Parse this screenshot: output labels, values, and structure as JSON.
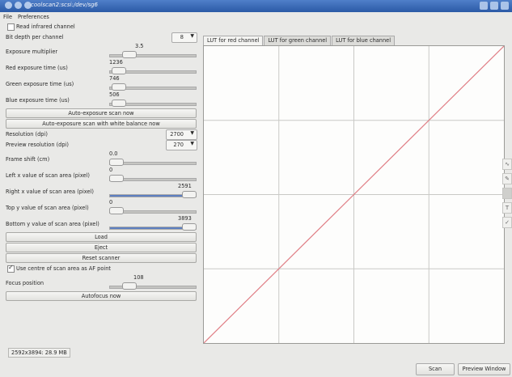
{
  "window": {
    "title": "coolscan2:scsi:/dev/sg6"
  },
  "menu": {
    "items": [
      "File",
      "Preferences"
    ]
  },
  "left": {
    "read_infrared_label": "Read infrared channel",
    "bit_depth_label": "Bit depth per channel",
    "bit_depth_value": "8",
    "exposure_multiplier_label": "Exposure multiplier",
    "exposure_multiplier_value": "3.5",
    "red_exposure_label": "Red exposure time (us)",
    "red_exposure_value": "1236",
    "green_exposure_label": "Green exposure time (us)",
    "green_exposure_value": "746",
    "blue_exposure_label": "Blue exposure time (us)",
    "blue_exposure_value": "506",
    "auto_exposure_btn": "Auto-exposure scan now",
    "auto_exposure_wb_btn": "Auto-exposure scan with white balance now",
    "resolution_label": "Resolution (dpi)",
    "resolution_value": "2700",
    "preview_res_label": "Preview resolution (dpi)",
    "preview_res_value": "270",
    "frame_shift_label": "Frame shift (cm)",
    "frame_shift_value": "0.0",
    "left_x_label": "Left x value of scan area (pixel)",
    "left_x_value": "0",
    "right_x_label": "Right x value of scan area (pixel)",
    "right_x_value": "2591",
    "top_y_label": "Top y value of scan area (pixel)",
    "top_y_value": "0",
    "bottom_y_label": "Bottom y value of scan area (pixel)",
    "bottom_y_value": "3893",
    "load_btn": "Load",
    "eject_btn": "Eject",
    "reset_btn": "Reset scanner",
    "use_centre_label": "Use centre of scan area as AF point",
    "focus_position_label": "Focus position",
    "focus_position_value": "108",
    "autofocus_btn": "Autofocus now",
    "status_text": "2592x3894: 28.9 MB"
  },
  "sliders": {
    "exposure_multiplier": 0.18,
    "red_exposure": 0.03,
    "green_exposure": 0.03,
    "blue_exposure": 0.03,
    "frame_shift": 0.0,
    "left_x": 0.0,
    "right_x": 1.0,
    "top_y": 0.0,
    "bottom_y": 1.0,
    "focus_position": 0.18
  },
  "checks": {
    "read_infrared": false,
    "use_centre": true
  },
  "tabs": [
    "LUT for red channel",
    "LUT for green channel",
    "LUT for blue channel"
  ],
  "active_tab": 0,
  "lut": {
    "line_color": "#e07f86",
    "grid_divisions": 4,
    "x_range": [
      0,
      1
    ],
    "y_range": [
      0,
      1
    ],
    "points": [
      [
        0,
        0
      ],
      [
        1,
        1
      ]
    ]
  },
  "side_tools": [
    "curve-tool-icon",
    "pencil-icon",
    "flat-tool-icon",
    "text-tool-icon",
    "check-icon"
  ],
  "bottom": {
    "scan_btn": "Scan",
    "preview_btn": "Preview Window"
  }
}
